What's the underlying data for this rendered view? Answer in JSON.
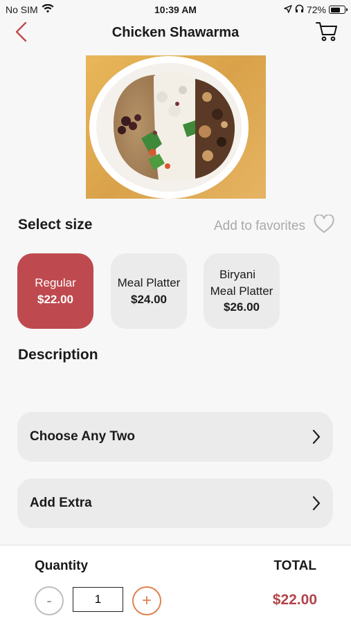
{
  "status_bar": {
    "carrier": "No SIM",
    "time": "10:39 AM",
    "battery": "72%",
    "battery_level": 0.72,
    "icons": [
      "wifi-icon",
      "location-arrow-icon",
      "headphones-icon",
      "battery-icon"
    ]
  },
  "header": {
    "title": "Chicken Shawarma",
    "back_icon": "chevron-left-icon",
    "cart_icon": "cart-icon"
  },
  "product": {
    "image": "food-plate-image"
  },
  "size": {
    "title": "Select size",
    "favorite_label": "Add to favorites",
    "options": [
      {
        "name": "Regular",
        "price": "$22.00",
        "selected": true
      },
      {
        "name": "Meal Platter",
        "price": "$24.00",
        "selected": false
      },
      {
        "name": "Biryani\nMeal Platter",
        "name_line1": "Biryani",
        "name_line2": "Meal Platter",
        "price": "$26.00",
        "selected": false
      }
    ]
  },
  "description": {
    "title": "Description"
  },
  "options": [
    {
      "label": "Choose Any Two"
    },
    {
      "label": "Add Extra"
    }
  ],
  "bottom": {
    "quantity_label": "Quantity",
    "quantity_value": "1",
    "minus": "-",
    "plus": "+",
    "total_label": "TOTAL",
    "total_value": "$22.00"
  },
  "colors": {
    "accent": "#be4a4f",
    "price_text": "#b3434a",
    "plus_button": "#e0804f",
    "card_bg": "#ebebeb"
  }
}
